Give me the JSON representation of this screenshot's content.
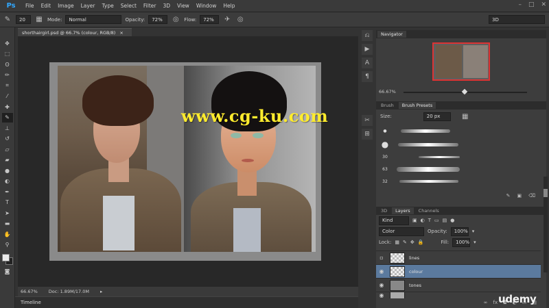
{
  "app": {
    "logo": "Ps",
    "window_controls": [
      "–",
      "□",
      "✕"
    ]
  },
  "menu": [
    "File",
    "Edit",
    "Image",
    "Layer",
    "Type",
    "Select",
    "Filter",
    "3D",
    "View",
    "Window",
    "Help"
  ],
  "options": {
    "brush_size": "20",
    "mode_label": "Mode:",
    "mode_value": "Normal",
    "opacity_label": "Opacity:",
    "opacity_value": "72%",
    "flow_label": "Flow:",
    "flow_value": "72%",
    "workspace": "3D"
  },
  "tools": [
    "move-icon",
    "marquee-icon",
    "lasso-icon",
    "quick-select-icon",
    "crop-icon",
    "eyedropper-icon",
    "healing-icon",
    "brush-icon",
    "stamp-icon",
    "history-brush-icon",
    "eraser-icon",
    "gradient-icon",
    "blur-icon",
    "dodge-icon",
    "pen-icon",
    "type-icon",
    "path-select-icon",
    "shape-icon",
    "hand-icon",
    "zoom-icon"
  ],
  "document": {
    "tab_title": "shorthairgirl.psd @ 66.7% (colour, RGB/8)",
    "tab_close": "×",
    "zoom": "66.67%",
    "doc_size": "Doc: 1.89M/17.0M",
    "watermark": "www.cg-ku.com"
  },
  "timeline": "Timeline",
  "navigator": {
    "title": "Navigator",
    "zoom": "66.67%"
  },
  "brush_panel": {
    "tabs": [
      "Brush",
      "Brush Presets"
    ],
    "size_label": "Size:",
    "size_value": "20 px",
    "presets": [
      "",
      "",
      "30",
      "63",
      "32"
    ]
  },
  "layers_panel": {
    "tabs": [
      "3D",
      "Layers",
      "Channels"
    ],
    "kind": "Kind",
    "blend_mode": "Color",
    "opacity_label": "Opacity:",
    "opacity_value": "100%",
    "lock_label": "Lock:",
    "fill_label": "Fill:",
    "fill_value": "100%",
    "layers": [
      {
        "name": "lines",
        "visible": false
      },
      {
        "name": "colour",
        "visible": true,
        "selected": true
      },
      {
        "name": "tones",
        "visible": true
      },
      {
        "name": "",
        "visible": true
      }
    ],
    "footer_icons": [
      "∞",
      "fx",
      "◘",
      "◐",
      "▭",
      "▤",
      "🗑"
    ]
  },
  "branding": "udemy"
}
